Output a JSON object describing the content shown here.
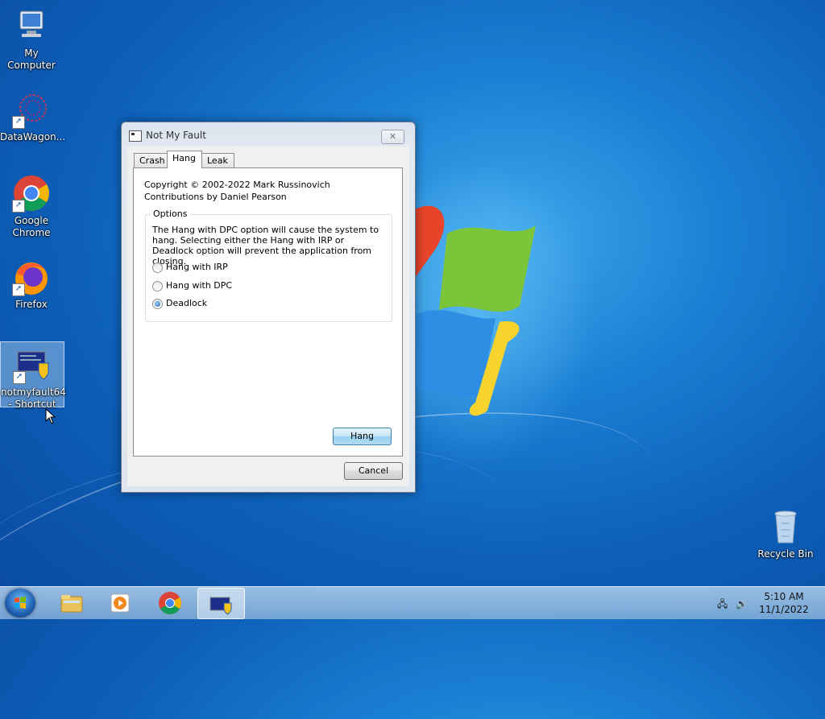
{
  "desktop": {
    "icons": [
      {
        "label": "My Computer"
      },
      {
        "label": "DataWagon..."
      },
      {
        "label": "Google Chrome"
      },
      {
        "label": "Firefox"
      },
      {
        "label": "notmyfault64 - Shortcut"
      },
      {
        "label": "Recycle Bin"
      }
    ]
  },
  "dialog": {
    "title": "Not My Fault",
    "close_glyph": "✕",
    "tabs": [
      {
        "label": "Crash"
      },
      {
        "label": "Hang"
      },
      {
        "label": "Leak"
      }
    ],
    "active_tab": "Hang",
    "copyright_line1": "Copyright © 2002-2022 Mark Russinovich",
    "copyright_line2": "Contributions by Daniel Pearson",
    "options": {
      "legend": "Options",
      "description": "The Hang with DPC option will cause the system to hang. Selecting either the Hang with IRP or Deadlock option will prevent the application from closing.",
      "radios": [
        {
          "label": "Hang with IRP",
          "checked": false
        },
        {
          "label": "Hang with DPC",
          "checked": false
        },
        {
          "label": "Deadlock",
          "checked": true
        }
      ]
    },
    "action_button": "Hang",
    "cancel_button": "Cancel"
  },
  "taskbar": {
    "pinned": [
      "start-orb",
      "explorer-icon",
      "media-player-icon",
      "chrome-icon",
      "notmyfault-icon"
    ],
    "time": "5:10 AM",
    "date": "11/1/2022"
  }
}
